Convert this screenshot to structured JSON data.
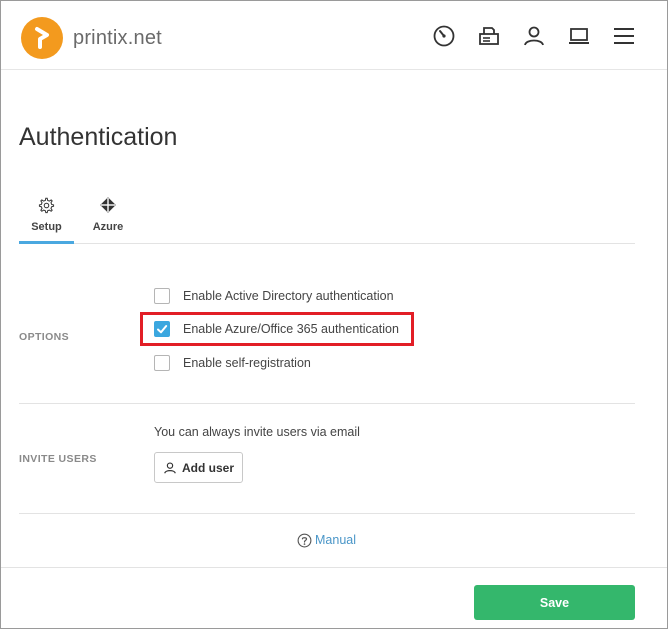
{
  "header": {
    "logo_text": "printix.net",
    "nav_icons": [
      "dashboard-icon",
      "printer-icon",
      "user-icon",
      "laptop-icon",
      "menu-icon"
    ]
  },
  "page": {
    "title": "Authentication"
  },
  "tabs": [
    {
      "label": "Setup",
      "icon": "gear-icon",
      "active": true
    },
    {
      "label": "Azure",
      "icon": "azure-icon",
      "active": false
    }
  ],
  "options_section": {
    "label": "OPTIONS",
    "options": [
      {
        "label": "Enable Active Directory authentication",
        "checked": false
      },
      {
        "label": "Enable Azure/Office 365 authentication",
        "checked": true,
        "highlighted": true
      },
      {
        "label": "Enable self-registration",
        "checked": false
      }
    ]
  },
  "invite_section": {
    "label": "INVITE USERS",
    "text": "You can always invite users via email",
    "button_label": "Add user"
  },
  "manual": {
    "label": "Manual"
  },
  "save": {
    "label": "Save"
  },
  "colors": {
    "accent_blue": "#3ba7df",
    "save_green": "#34b76c",
    "logo_orange": "#f39a1e",
    "highlight_red": "#e21e26"
  }
}
